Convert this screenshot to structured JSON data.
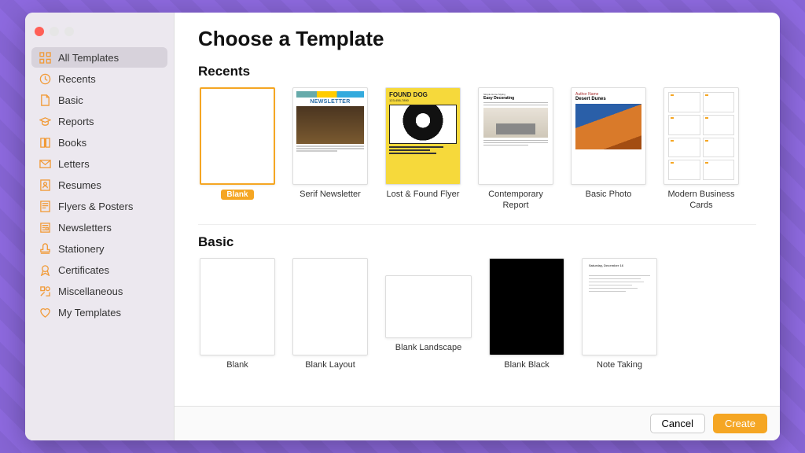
{
  "header": {
    "title": "Choose a Template"
  },
  "sidebar": {
    "items": [
      {
        "label": "All Templates",
        "icon": "grid"
      },
      {
        "label": "Recents",
        "icon": "clock"
      },
      {
        "label": "Basic",
        "icon": "doc"
      },
      {
        "label": "Reports",
        "icon": "cap"
      },
      {
        "label": "Books",
        "icon": "book"
      },
      {
        "label": "Letters",
        "icon": "mail"
      },
      {
        "label": "Resumes",
        "icon": "person"
      },
      {
        "label": "Flyers & Posters",
        "icon": "flyer"
      },
      {
        "label": "Newsletters",
        "icon": "news"
      },
      {
        "label": "Stationery",
        "icon": "stamp"
      },
      {
        "label": "Certificates",
        "icon": "ribbon"
      },
      {
        "label": "Miscellaneous",
        "icon": "misc"
      },
      {
        "label": "My Templates",
        "icon": "heart"
      }
    ]
  },
  "sections": {
    "recents": {
      "heading": "Recents",
      "items": [
        {
          "label": "Blank",
          "selected": true
        },
        {
          "label": "Serif Newsletter",
          "thumb_title": "NEWSLETTER"
        },
        {
          "label": "Lost & Found Flyer",
          "thumb_title": "FOUND DOG",
          "thumb_sub": "123-456-7890"
        },
        {
          "label": "Contemporary Report",
          "thumb_title": "Easy Decorating",
          "thumb_over": "Simple Home Styling"
        },
        {
          "label": "Basic Photo",
          "thumb_title": "Desert Dunes",
          "thumb_over": "Author Name"
        },
        {
          "label": "Modern Business Cards"
        }
      ]
    },
    "basic": {
      "heading": "Basic",
      "items": [
        {
          "label": "Blank"
        },
        {
          "label": "Blank Layout"
        },
        {
          "label": "Blank Landscape",
          "landscape": true
        },
        {
          "label": "Blank Black"
        },
        {
          "label": "Note Taking"
        }
      ]
    }
  },
  "footer": {
    "cancel": "Cancel",
    "create": "Create"
  }
}
